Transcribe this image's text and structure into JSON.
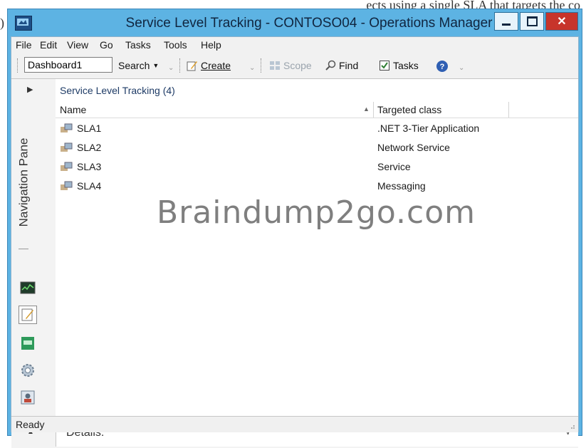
{
  "window": {
    "title": "Service Level Tracking - CONTOSO04 - Operations Manager",
    "top_fragment": "ects using a single SLA that targets the co"
  },
  "caption_buttons": {
    "minimize": "—",
    "maximize": "▢",
    "close": "✕"
  },
  "menu": [
    "File",
    "Edit",
    "View",
    "Go",
    "Tasks",
    "Tools",
    "Help"
  ],
  "toolbar": {
    "dashboard_value": "Dashboard1",
    "search": "Search",
    "create": "Create",
    "scope": "Scope",
    "find": "Find",
    "tasks": "Tasks"
  },
  "navigation": {
    "title": "Navigation Pane"
  },
  "content": {
    "heading": "Service Level Tracking (4)",
    "columns": {
      "name": "Name",
      "targeted_class": "Targeted class"
    },
    "rows": [
      {
        "name": "SLA1",
        "targeted_class": ".NET 3-Tier Application"
      },
      {
        "name": "SLA2",
        "targeted_class": "Network Service"
      },
      {
        "name": "SLA3",
        "targeted_class": "Service"
      },
      {
        "name": "SLA4",
        "targeted_class": "Messaging"
      }
    ]
  },
  "watermark": "Braindump2go.com",
  "details": {
    "label": "Details:"
  },
  "status": {
    "text": "Ready"
  },
  "colors": {
    "title_bar": "#5db3e3",
    "close_button": "#c7342b",
    "heading_text": "#1e3b66"
  }
}
